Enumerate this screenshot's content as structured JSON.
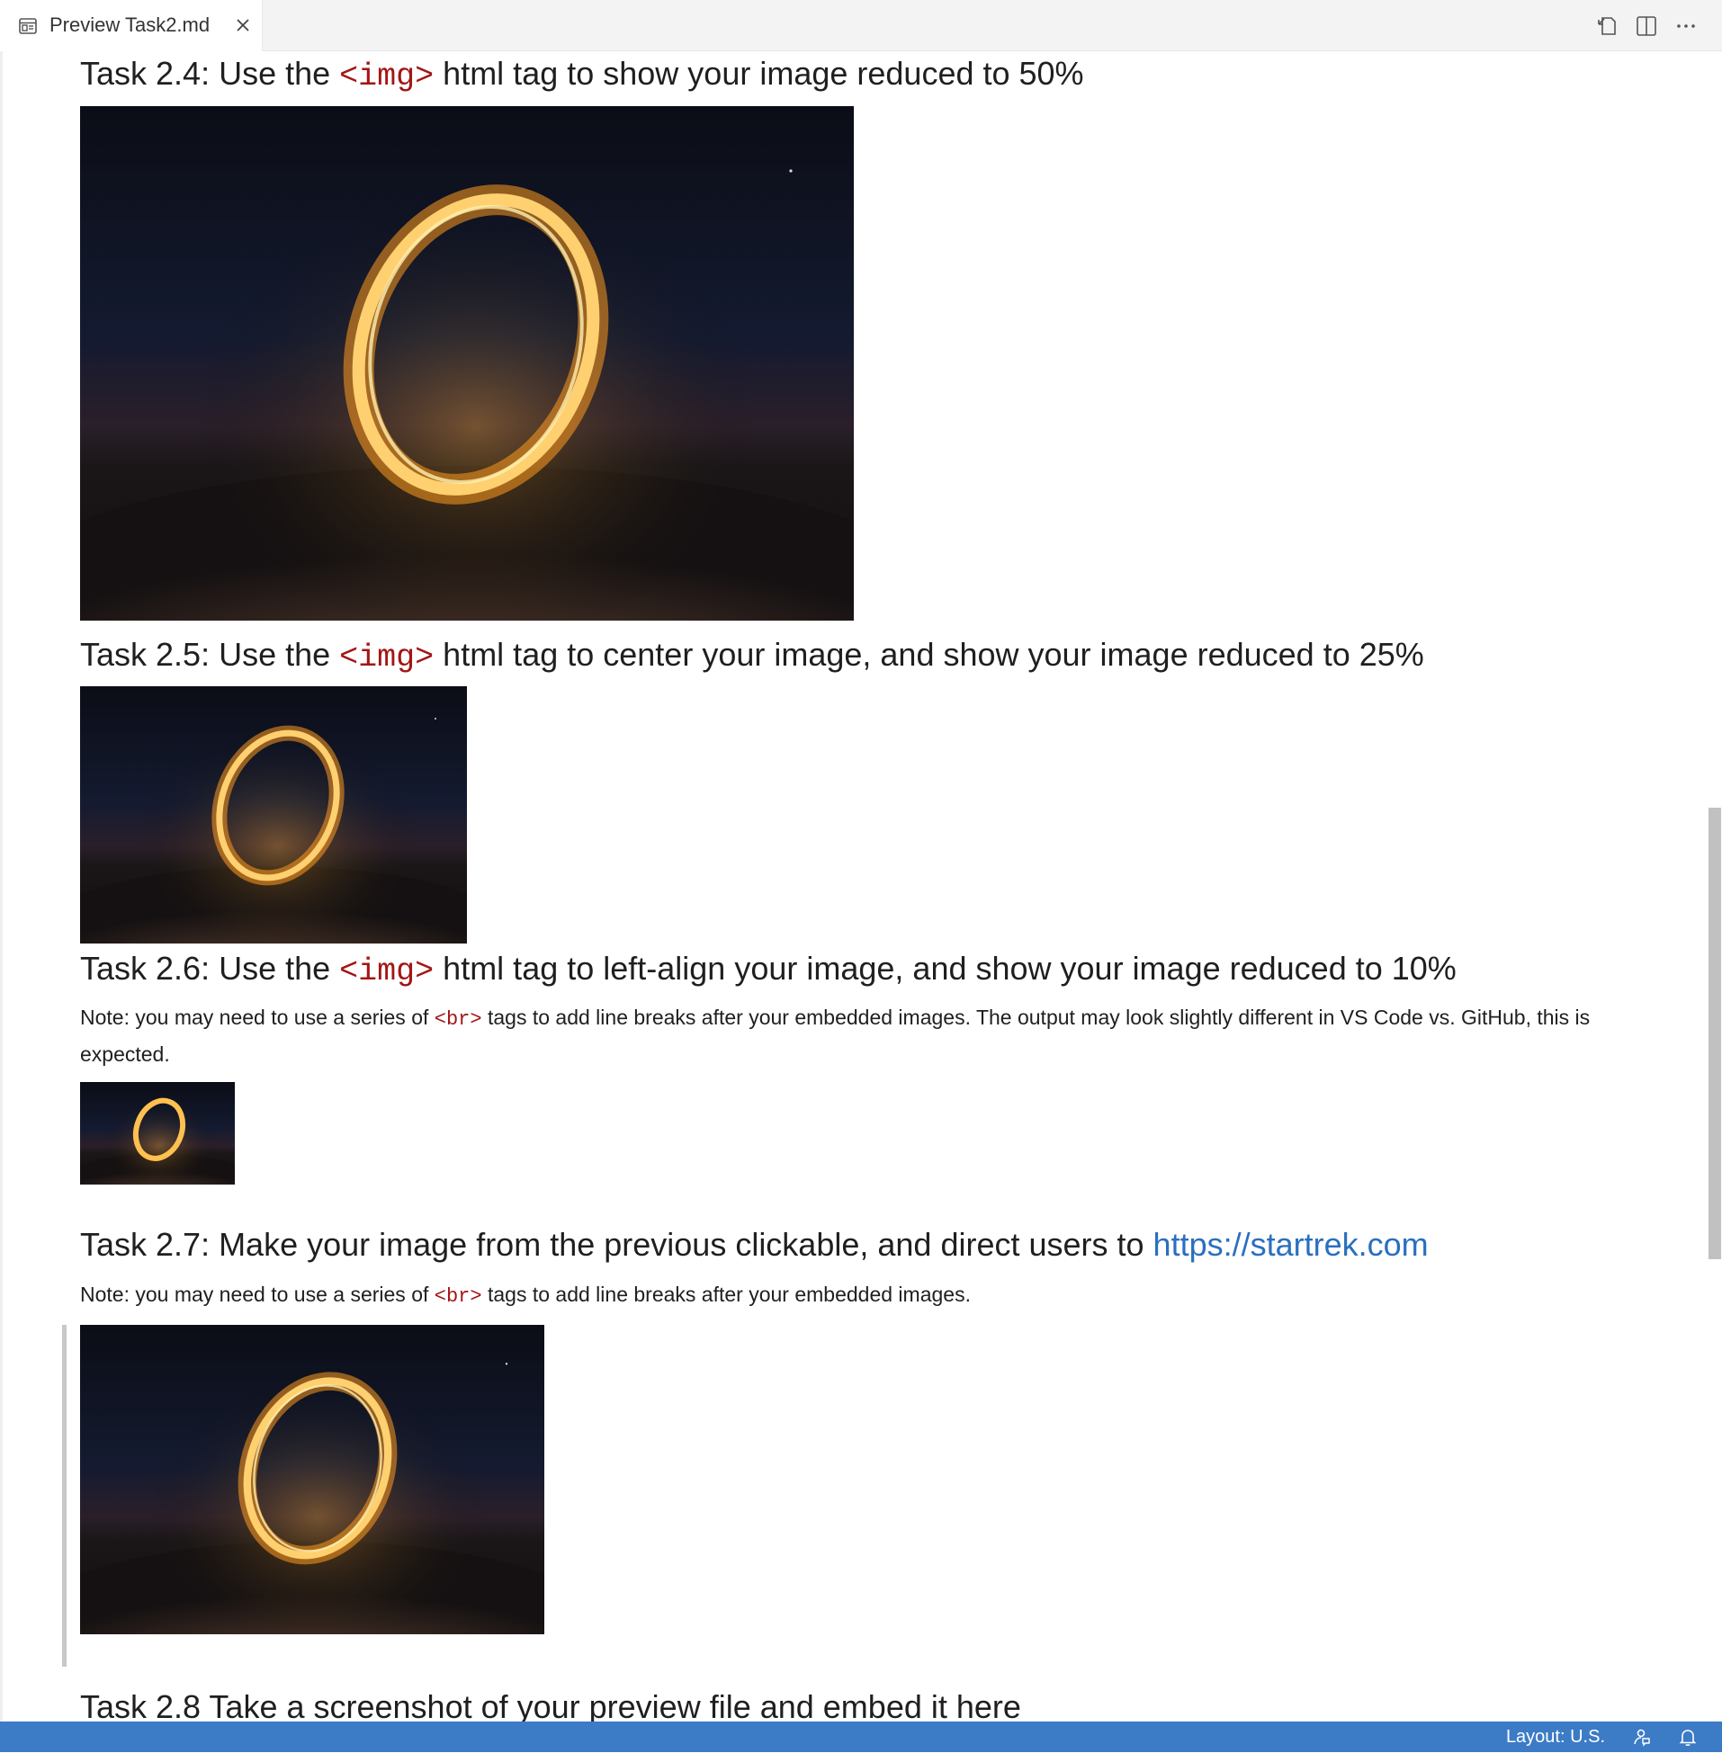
{
  "tab": {
    "title": "Preview Task2.md"
  },
  "doc": {
    "h24": {
      "pre": "Task 2.4: Use the ",
      "code": "<img>",
      "post": " html tag to show your image reduced to 50%"
    },
    "h25": {
      "pre": "Task 2.5: Use the ",
      "code": "<img>",
      "post": " html tag to center your image, and show your image reduced to 25%"
    },
    "h26": {
      "pre": "Task 2.6: Use the ",
      "code": "<img>",
      "post": " html tag to left-align your image, and show your image reduced to 10%"
    },
    "note26": {
      "pre": "Note: you may need to use a series of ",
      "code": "<br>",
      "post": " tags to add line breaks after your embedded images. The output may look slightly different in VS Code vs. GitHub, this is expected."
    },
    "h27": {
      "pre": "Task 2.7: Make your image from the previous clickable, and direct users to ",
      "link": "https://startrek.com"
    },
    "note27": {
      "pre": "Note: you may need to use a series of ",
      "code": "<br>",
      "post": " tags to add line breaks after your embedded images."
    },
    "h28": "Task 2.8 Take a screenshot of your preview file and embed it here"
  },
  "status": {
    "layout": "Layout: U.S."
  },
  "icons": {
    "tab": "preview-icon",
    "close": "close-icon",
    "open_source": "open-source-icon",
    "split": "split-editor-icon",
    "more": "more-actions-icon",
    "feedback": "feedback-icon",
    "bell": "notifications-bell-icon"
  },
  "colors": {
    "accent": "#3c7bc6",
    "code": "#a31515",
    "link": "#2a6fbf"
  }
}
